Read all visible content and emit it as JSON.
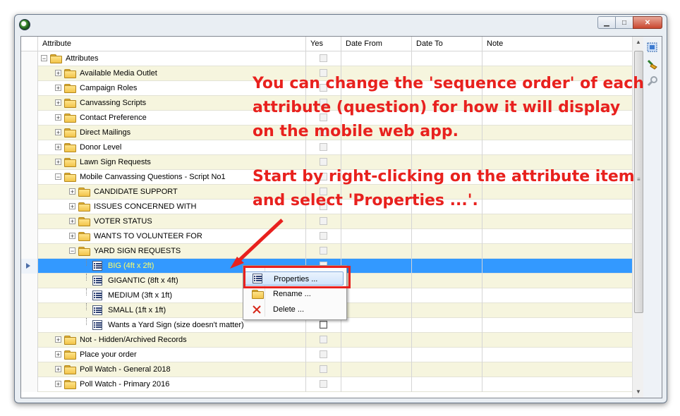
{
  "columns": [
    "Attribute",
    "Yes",
    "Date From",
    "Date To",
    "Note"
  ],
  "rows": [
    {
      "label": "Attributes",
      "type": "folder",
      "level": 0,
      "expanded": true,
      "alt": false,
      "checked": false
    },
    {
      "label": "Available Media Outlet",
      "type": "folder",
      "level": 1,
      "expanded": false,
      "alt": true,
      "checked": false
    },
    {
      "label": "Campaign Roles",
      "type": "folder",
      "level": 1,
      "expanded": false,
      "alt": false,
      "checked": false
    },
    {
      "label": "Canvassing Scripts",
      "type": "folder",
      "level": 1,
      "expanded": false,
      "alt": true,
      "checked": false
    },
    {
      "label": "Contact Preference",
      "type": "folder",
      "level": 1,
      "expanded": false,
      "alt": false,
      "checked": false
    },
    {
      "label": "Direct Mailings",
      "type": "folder",
      "level": 1,
      "expanded": false,
      "alt": true,
      "checked": false
    },
    {
      "label": "Donor Level",
      "type": "folder",
      "level": 1,
      "expanded": false,
      "alt": false,
      "checked": false
    },
    {
      "label": "Lawn Sign Requests",
      "type": "folder",
      "level": 1,
      "expanded": false,
      "alt": true,
      "checked": false
    },
    {
      "label": "Mobile Canvassing Questions - Script No1",
      "type": "folder",
      "level": 1,
      "expanded": true,
      "alt": false,
      "checked": false
    },
    {
      "label": "CANDIDATE SUPPORT",
      "type": "folder",
      "level": 2,
      "expanded": false,
      "alt": true,
      "checked": false
    },
    {
      "label": "ISSUES CONCERNED WITH",
      "type": "folder",
      "level": 2,
      "expanded": false,
      "alt": false,
      "checked": false
    },
    {
      "label": "VOTER STATUS",
      "type": "folder",
      "level": 2,
      "expanded": false,
      "alt": true,
      "checked": false
    },
    {
      "label": "WANTS TO VOLUNTEER FOR",
      "type": "folder",
      "level": 2,
      "expanded": false,
      "alt": false,
      "checked": false
    },
    {
      "label": "YARD SIGN REQUESTS",
      "type": "folder",
      "level": 2,
      "expanded": true,
      "alt": true,
      "checked": false
    },
    {
      "label": "BIG (4ft x 2ft)",
      "type": "item",
      "level": 3,
      "alt": false,
      "checked": false,
      "selected": true
    },
    {
      "label": "GIGANTIC (8ft x 4ft)",
      "type": "item",
      "level": 3,
      "alt": true,
      "checked": false
    },
    {
      "label": "MEDIUM (3ft x 1ft)",
      "type": "item",
      "level": 3,
      "alt": false,
      "checked": false
    },
    {
      "label": "SMALL (1ft x 1ft)",
      "type": "item",
      "level": 3,
      "alt": true,
      "checked": false
    },
    {
      "label": "Wants a Yard Sign (size doesn't matter)",
      "type": "item",
      "level": 3,
      "alt": false,
      "checked": true
    },
    {
      "label": "Not - Hidden/Archived Records",
      "type": "folder",
      "level": 1,
      "expanded": false,
      "alt": true,
      "checked": false
    },
    {
      "label": "Place your order",
      "type": "folder",
      "level": 1,
      "expanded": false,
      "alt": false,
      "checked": false
    },
    {
      "label": "Poll Watch - General 2018",
      "type": "folder",
      "level": 1,
      "expanded": false,
      "alt": true,
      "checked": false
    },
    {
      "label": "Poll Watch - Primary 2016",
      "type": "folder",
      "level": 1,
      "expanded": false,
      "alt": false,
      "checked": false
    }
  ],
  "annotation": {
    "line1": "You can change the 'sequence order' of each",
    "line2": "attribute (question) for how it will display",
    "line3": "on the mobile web app.",
    "line4": "Start by right-clicking on the attribute item",
    "line5": "and select 'Properties ...'.",
    "color": "#e8211e"
  },
  "context_menu": {
    "items": [
      {
        "label": "Properties ...",
        "icon": "list-icon",
        "highlighted": true
      },
      {
        "label": "Rename ...",
        "icon": "folder-icon",
        "highlighted": false
      },
      {
        "label": "Delete ...",
        "icon": "delete-x-icon",
        "highlighted": false
      }
    ]
  },
  "toolbar": {
    "icons": [
      "select-all-icon",
      "sweep-brush-icon",
      "search-icon"
    ]
  },
  "colors": {
    "selection": "#3399ff",
    "alt_row": "#f6f5de",
    "selected_text": "#ffff66"
  }
}
